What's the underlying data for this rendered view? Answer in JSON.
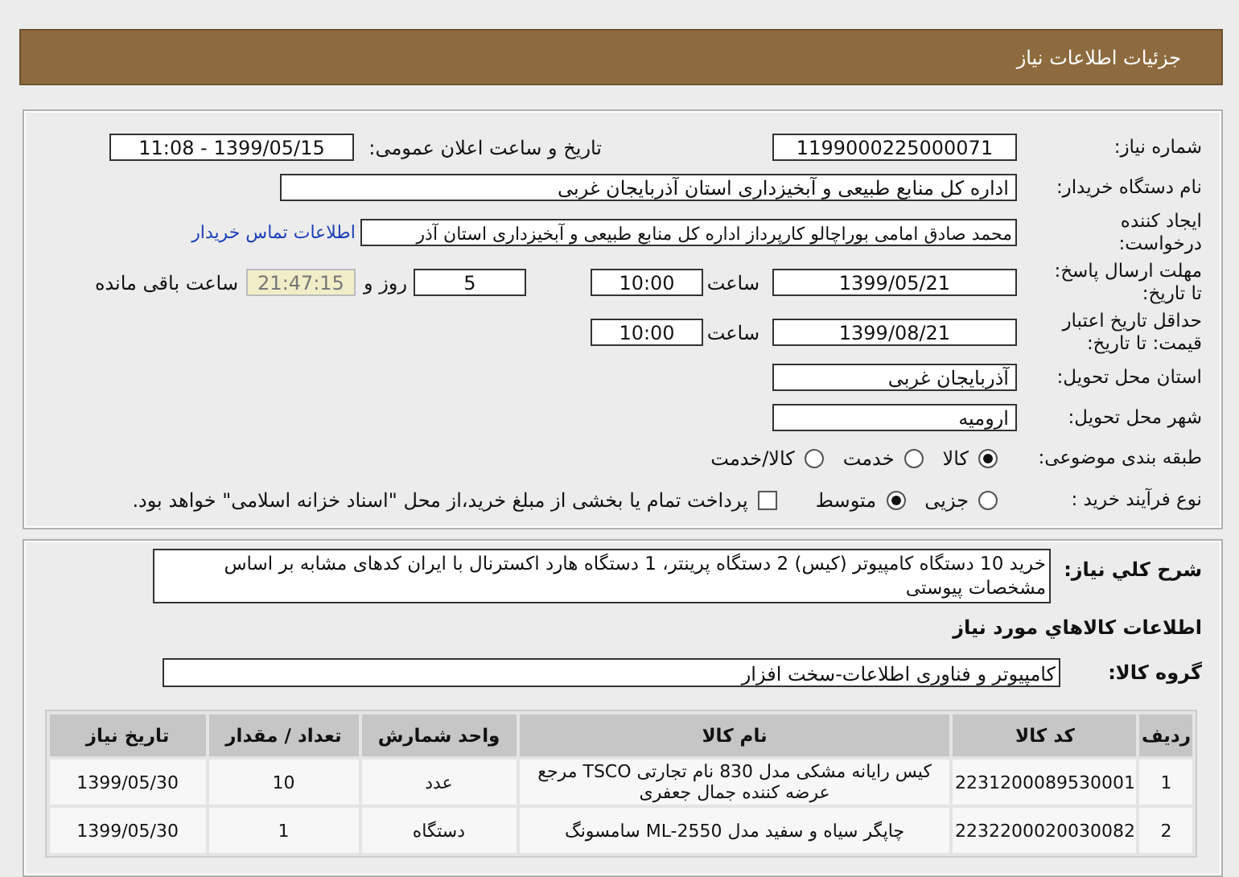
{
  "header": {
    "title": "جزئیات اطلاعات نیاز"
  },
  "need_info": {
    "need_number": {
      "label": "شماره نیاز:",
      "value": "1199000225000071"
    },
    "announce_datetime": {
      "label": "تاریخ و ساعت اعلان عمومی:",
      "value": "1399/05/15 - 11:08"
    },
    "buyer_org": {
      "label": "نام دستگاه خریدار:",
      "value": "اداره کل منابع طبیعی و آبخیزداری استان آذربایجان غربی"
    },
    "requester": {
      "label": "ایجاد کننده\nدرخواست:",
      "value": "محمد صادق امامی بوراچالو کارپرداز اداره کل منابع طبیعی و آبخیزداری استان آذر",
      "contact_link": "اطلاعات تماس خریدار"
    },
    "reply_deadline": {
      "label": "مهلت ارسال پاسخ:\nتا تاریخ:",
      "date": "1399/05/21",
      "time_label": "ساعت",
      "time": "10:00",
      "days": "5",
      "days_suffix": "روز و",
      "remaining": "21:47:15",
      "remaining_suffix": "ساعت باقی مانده"
    },
    "price_validity": {
      "label": "حداقل تاریخ اعتبار\nقیمت: تا تاریخ:",
      "date": "1399/08/21",
      "time_label": "ساعت",
      "time": "10:00"
    },
    "delivery_province": {
      "label": "استان محل تحویل:",
      "value": "آذربایجان غربی"
    },
    "delivery_city": {
      "label": "شهر محل تحویل:",
      "value": "ارومیه"
    },
    "category": {
      "label": "طبقه بندی موضوعی:",
      "options": [
        {
          "label": "کالا",
          "selected": true
        },
        {
          "label": "خدمت",
          "selected": false
        },
        {
          "label": "کالا/خدمت",
          "selected": false
        }
      ]
    },
    "purchase_process": {
      "label": "نوع فرآیند خرید :",
      "options": [
        {
          "label": "جزیی",
          "selected": false
        },
        {
          "label": "متوسط",
          "selected": true
        }
      ],
      "payment_checkbox": {
        "label": "پرداخت تمام یا بخشی از مبلغ خرید،از محل \"اسناد خزانه اسلامی\" خواهد بود.",
        "checked": false
      }
    }
  },
  "description": {
    "label": "شرح کلي نياز:",
    "value": "خرید 10 دستگاه کامپیوتر (کیس) 2 دستگاه پرینتر، 1 دستگاه هارد اکسترنال با ایران کدهای مشابه بر اساس مشخصات پیوستی"
  },
  "goods_section_title": "اطلاعات کالاهاي مورد نياز",
  "goods_group": {
    "label": "گروه کالا:",
    "value": "کامپیوتر و فناوری اطلاعات-سخت افزار"
  },
  "table": {
    "columns": [
      "ردیف",
      "کد کالا",
      "نام کالا",
      "واحد شمارش",
      "تعداد / مقدار",
      "تاریخ نیاز"
    ],
    "rows": [
      [
        "1",
        "2231200089530001",
        "کیس رایانه مشکی مدل 830 نام تجارتی TSCO مرجع عرضه کننده جمال جعفری",
        "عدد",
        "10",
        "1399/05/30"
      ],
      [
        "2",
        "2232200020030082",
        "چاپگر سیاه و سفید مدل ML-2550 سامسونگ",
        "دستگاه",
        "1",
        "1399/05/30"
      ]
    ]
  }
}
